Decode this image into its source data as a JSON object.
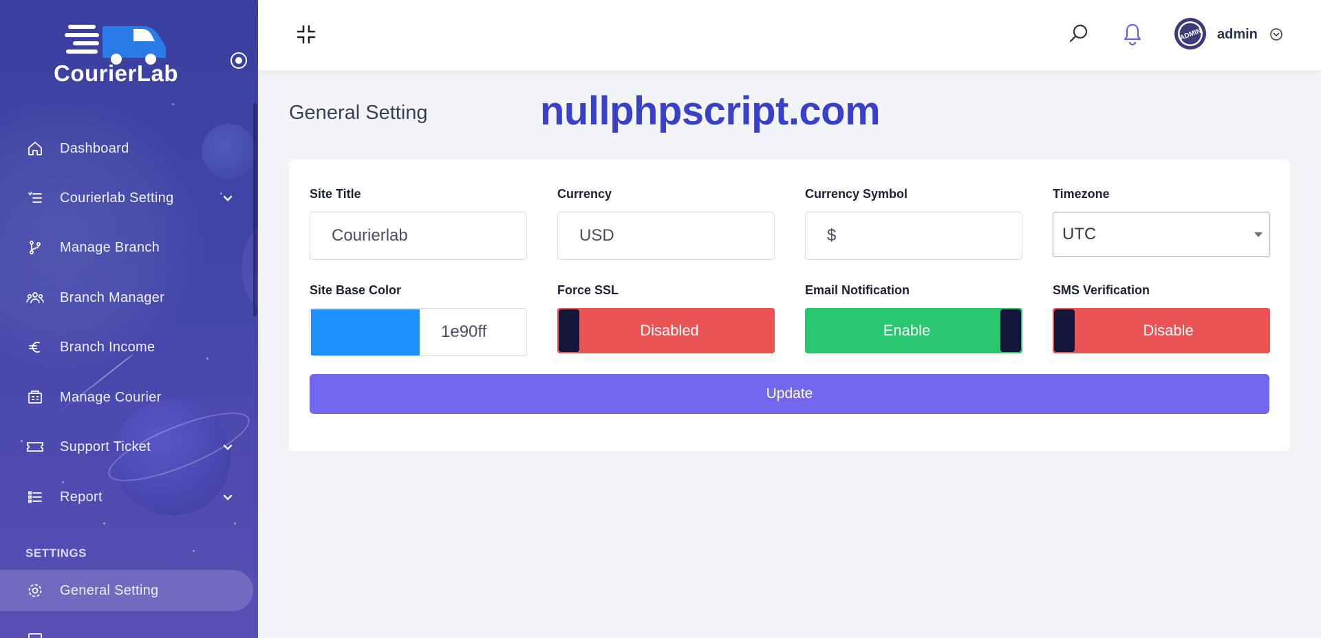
{
  "brand": {
    "name_part1": "Courier",
    "name_part2": "Lab"
  },
  "sidebar": {
    "items": [
      {
        "label": "Dashboard",
        "icon": "home-icon"
      },
      {
        "label": "Courierlab Setting",
        "icon": "list-settings-icon",
        "has_submenu": true
      },
      {
        "label": "Manage Branch",
        "icon": "branch-icon"
      },
      {
        "label": "Branch Manager",
        "icon": "users-icon"
      },
      {
        "label": "Branch Income",
        "icon": "euro-icon"
      },
      {
        "label": "Manage Courier",
        "icon": "courier-icon"
      },
      {
        "label": "Support Ticket",
        "icon": "ticket-icon",
        "has_submenu": true
      },
      {
        "label": "Report",
        "icon": "report-list-icon",
        "has_submenu": true
      }
    ],
    "section_label": "SETTINGS",
    "active_item": {
      "label": "General Setting",
      "icon": "settings-gear-icon"
    }
  },
  "topbar": {
    "user_name": "admin",
    "avatar_text": "ADMIN"
  },
  "page": {
    "title": "General Setting",
    "watermark": "nullphpscript.com"
  },
  "form": {
    "site_title": {
      "label": "Site Title",
      "value": "Courierlab"
    },
    "currency": {
      "label": "Currency",
      "value": "USD"
    },
    "currency_symbol": {
      "label": "Currency Symbol",
      "value": "$"
    },
    "timezone": {
      "label": "Timezone",
      "value": "UTC"
    },
    "base_color": {
      "label": "Site Base Color",
      "value": "1e90ff",
      "swatch": "#1e90ff"
    },
    "force_ssl": {
      "label": "Force SSL",
      "state": "Disabled"
    },
    "email_notification": {
      "label": "Email Notification",
      "state": "Enable"
    },
    "sms_verification": {
      "label": "SMS Verification",
      "state": "Disable"
    },
    "submit_label": "Update"
  },
  "colors": {
    "accent": "#7367f0",
    "success": "#28c76f",
    "danger": "#ea5455",
    "sidebar": "#3f44a6"
  }
}
